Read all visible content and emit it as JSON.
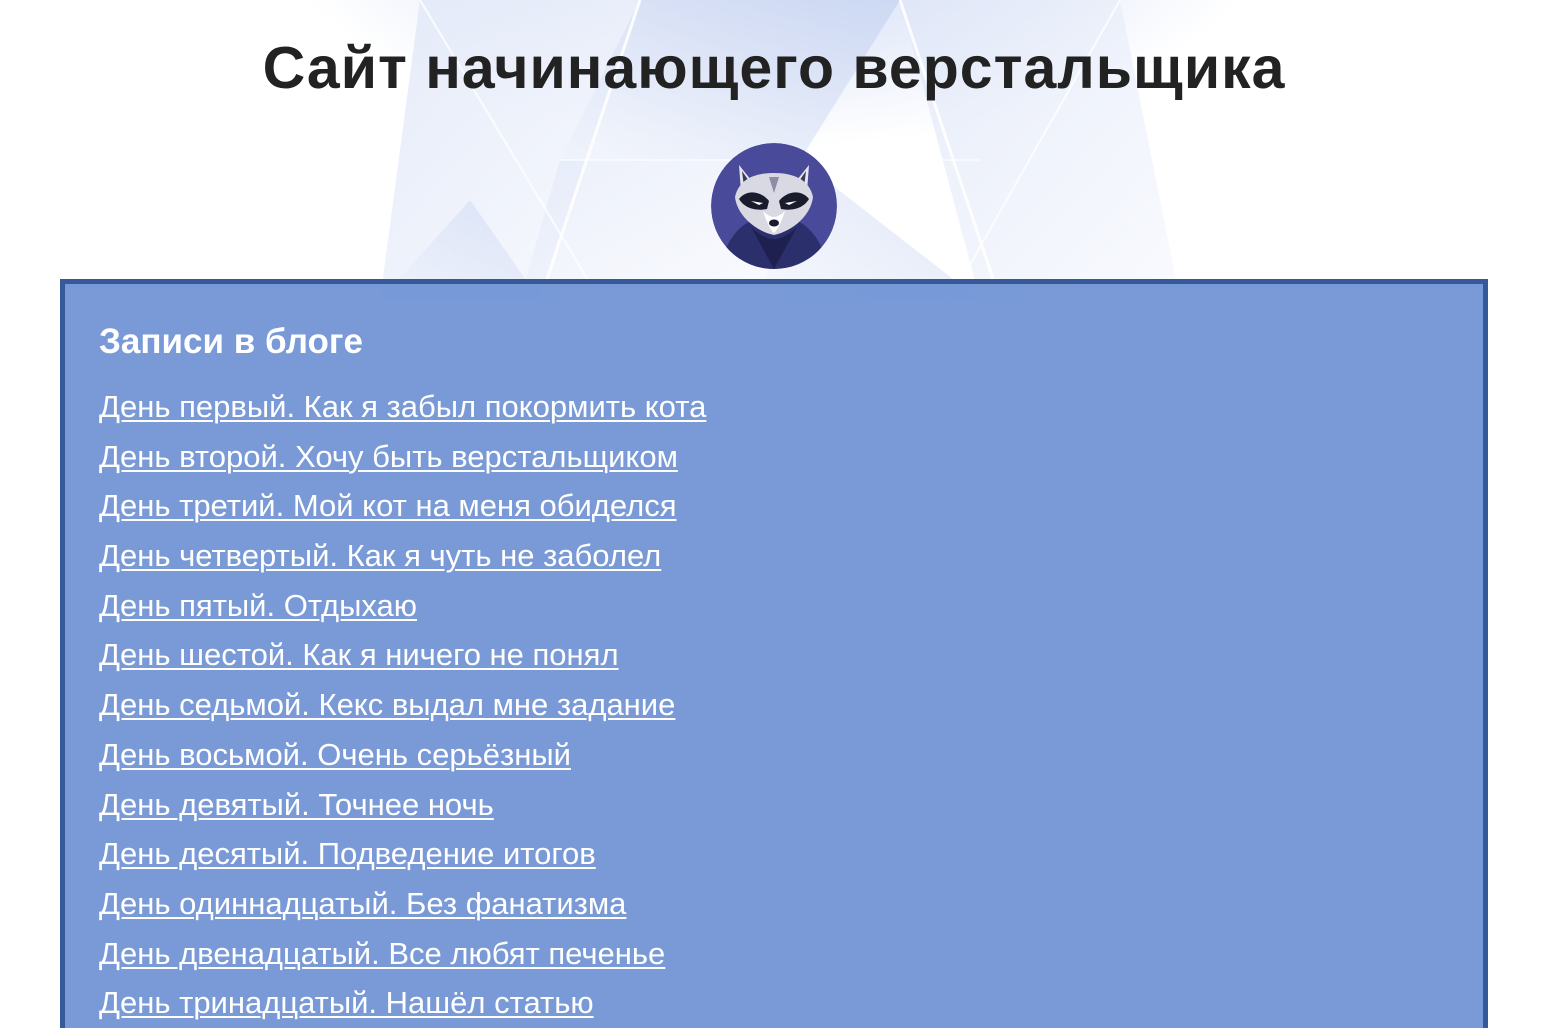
{
  "header": {
    "title": "Сайт начинающего верстальщика"
  },
  "avatar": {
    "icon": "raccoon-icon"
  },
  "blog": {
    "heading": "Записи в блоге",
    "items": [
      {
        "label": "День первый. Как я забыл покормить кота"
      },
      {
        "label": "День второй. Хочу быть верстальщиком"
      },
      {
        "label": "День третий. Мой кот на меня обиделся"
      },
      {
        "label": "День четвертый. Как я чуть не заболел"
      },
      {
        "label": "День пятый. Отдыхаю"
      },
      {
        "label": "День шестой. Как я ничего не понял"
      },
      {
        "label": "День седьмой. Кекс выдал мне задание"
      },
      {
        "label": "День восьмой. Очень серьёзный"
      },
      {
        "label": "День девятый. Точнее ночь"
      },
      {
        "label": "День десятый. Подведение итогов"
      },
      {
        "label": "День одиннадцатый. Без фанатизма"
      },
      {
        "label": "День двенадцатый. Все любят печенье"
      },
      {
        "label": "День тринадцатый. Нашёл статью"
      }
    ]
  },
  "colors": {
    "panel_background": "#7a99d6",
    "panel_border": "#345a9a",
    "title_text": "#222222",
    "link_text": "#ffffff"
  }
}
